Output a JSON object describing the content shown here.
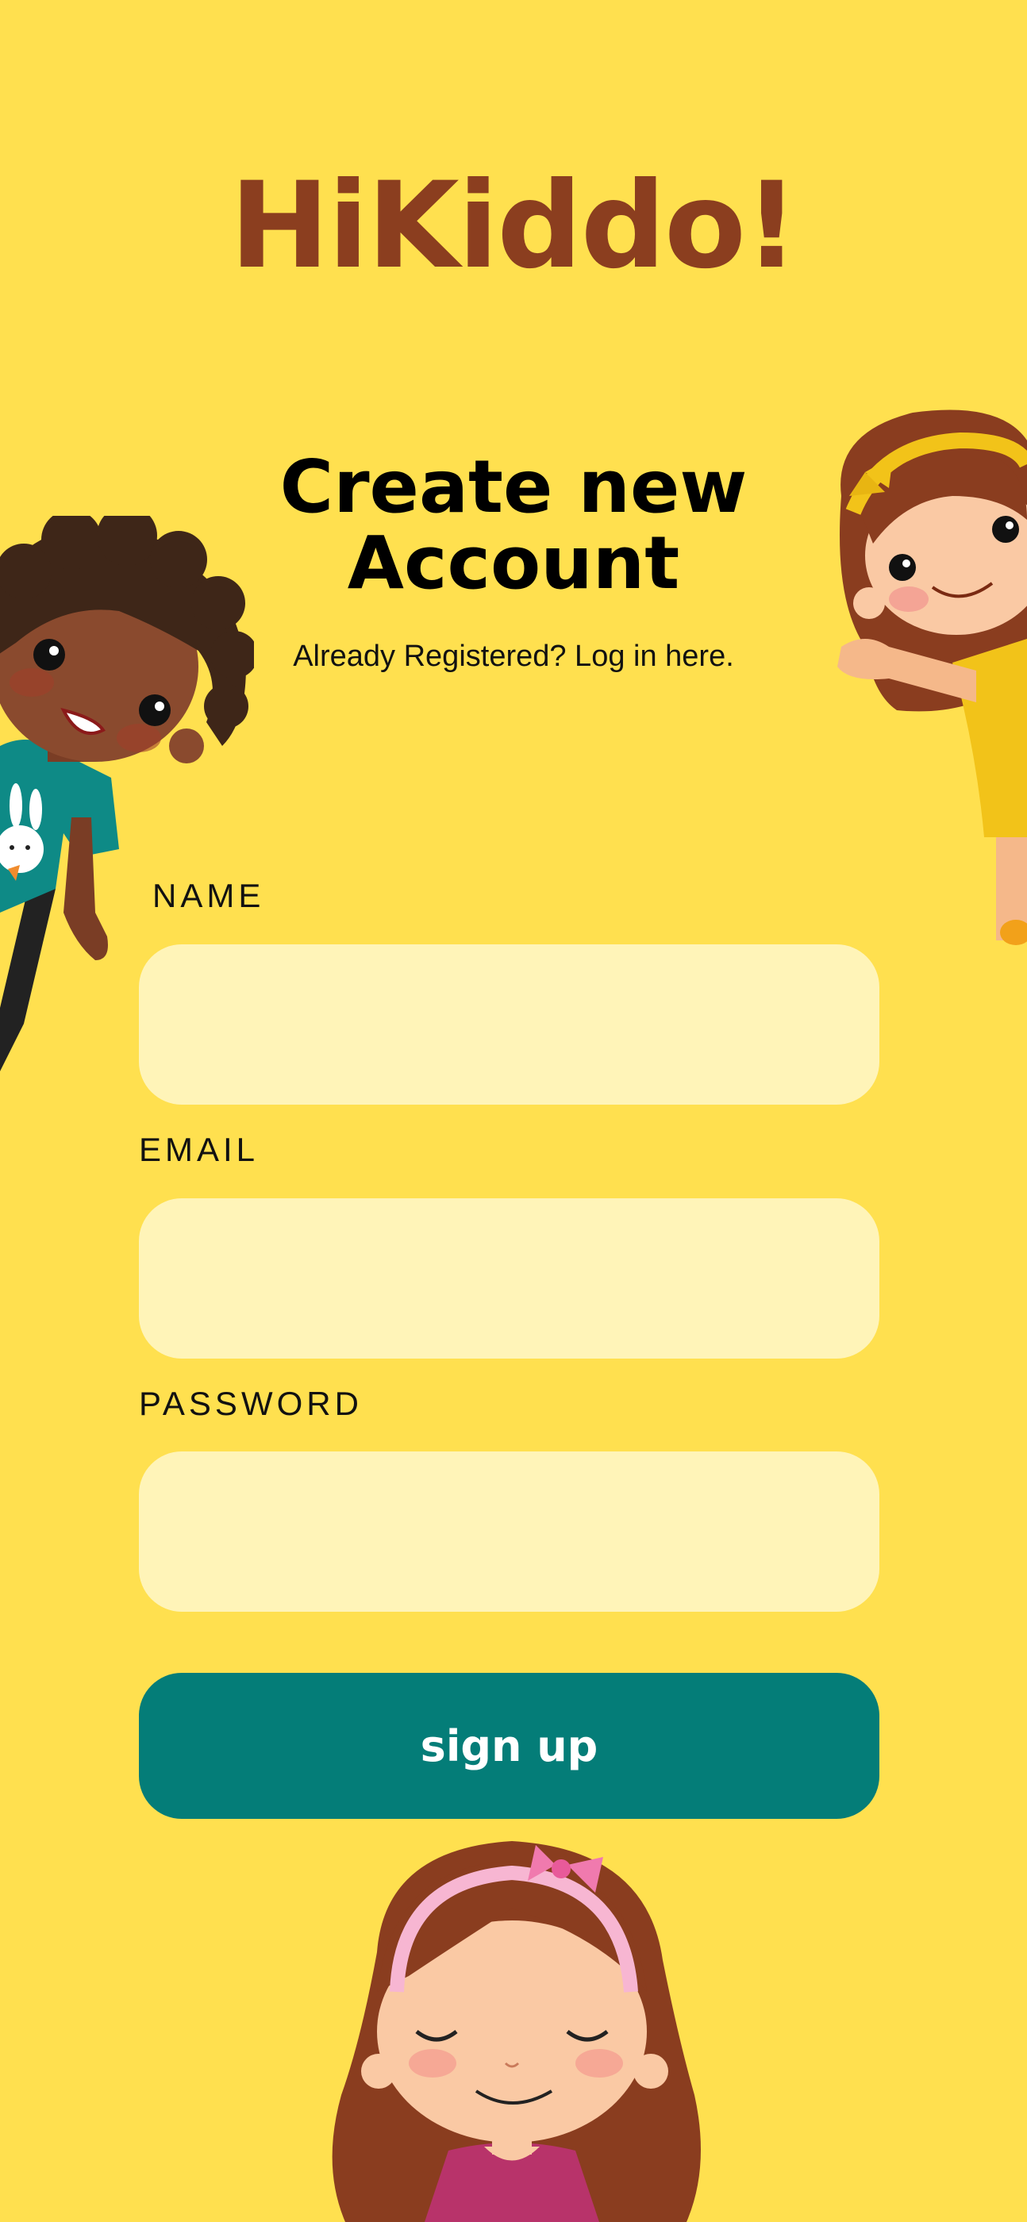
{
  "app": {
    "brand": "HiKiddo!"
  },
  "header": {
    "title": "Create new Account",
    "login_prompt": "Already Registered? Log in here."
  },
  "form": {
    "name_label": "NAME",
    "name_value": "",
    "email_label": "EMAIL",
    "email_value": "",
    "password_label": "PASSWORD",
    "password_value": "",
    "submit_label": "sign up"
  },
  "colors": {
    "background": "#FFE04F",
    "brand": "#8B3E1F",
    "input_fill": "#FFF4B8",
    "button": "#047D78"
  },
  "illustrations": [
    "boy-illustration",
    "girl-waving-illustration",
    "girl-smiling-illustration"
  ]
}
